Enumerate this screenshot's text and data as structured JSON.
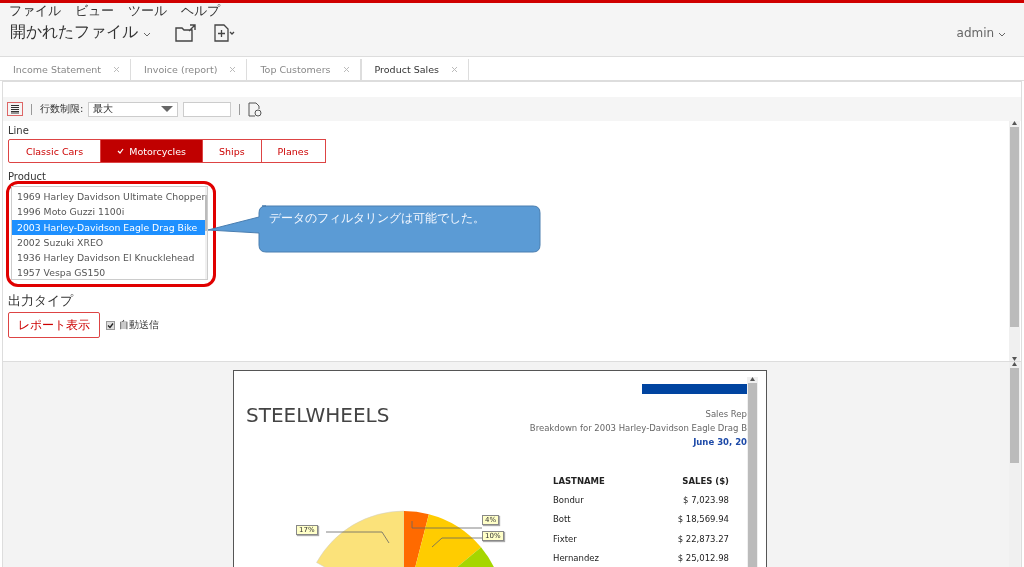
{
  "menu": [
    "ファイル",
    "ビュー",
    "ツール",
    "ヘルプ"
  ],
  "header": {
    "title": "開かれたファイル",
    "user": "admin"
  },
  "tabs": [
    {
      "label": "Income Statement",
      "selected": false
    },
    {
      "label": "Invoice (report)",
      "selected": false
    },
    {
      "label": "Top Customers",
      "selected": false
    },
    {
      "label": "Product Sales",
      "selected": true
    }
  ],
  "toolbar": {
    "row_limit_label": "行数制限:",
    "row_limit_value": "最大"
  },
  "line": {
    "label": "Line",
    "options": [
      {
        "label": "Classic Cars",
        "selected": false
      },
      {
        "label": "Motorcycles",
        "selected": true
      },
      {
        "label": "Ships",
        "selected": false
      },
      {
        "label": "Planes",
        "selected": false
      }
    ]
  },
  "product": {
    "label": "Product",
    "items": [
      {
        "label": "1969 Harley Davidson Ultimate Chopper",
        "selected": false
      },
      {
        "label": "1996 Moto Guzzi 1100i",
        "selected": false
      },
      {
        "label": "2003 Harley-Davidson Eagle Drag Bike",
        "selected": true
      },
      {
        "label": "2002 Suzuki XREO",
        "selected": false
      },
      {
        "label": "1936 Harley Davidson El Knucklehead",
        "selected": false
      },
      {
        "label": "1957 Vespa GS150",
        "selected": false
      }
    ]
  },
  "callout": "データのフィルタリングは可能でした。",
  "output": {
    "label": "出力タイプ",
    "button": "レポート表示",
    "auto_submit": {
      "label": "自動送信",
      "checked": true
    }
  },
  "report": {
    "brand": "STEELWHEELS",
    "title": "Sales Rep",
    "subtitle": "Breakdown for 2003 Harley-Davidson Eagle Drag B",
    "date": "June 30, 20",
    "columns": [
      "LASTNAME",
      "SALES ($)"
    ],
    "rows": [
      [
        "Bondur",
        "$ 7,023.98"
      ],
      [
        "Bott",
        "$ 18,569.94"
      ],
      [
        "Fixter",
        "$ 22,873.27"
      ],
      [
        "Hernandez",
        "$ 25,012.98"
      ]
    ],
    "pie_labels": [
      "17%",
      "4%",
      "10%"
    ]
  }
}
